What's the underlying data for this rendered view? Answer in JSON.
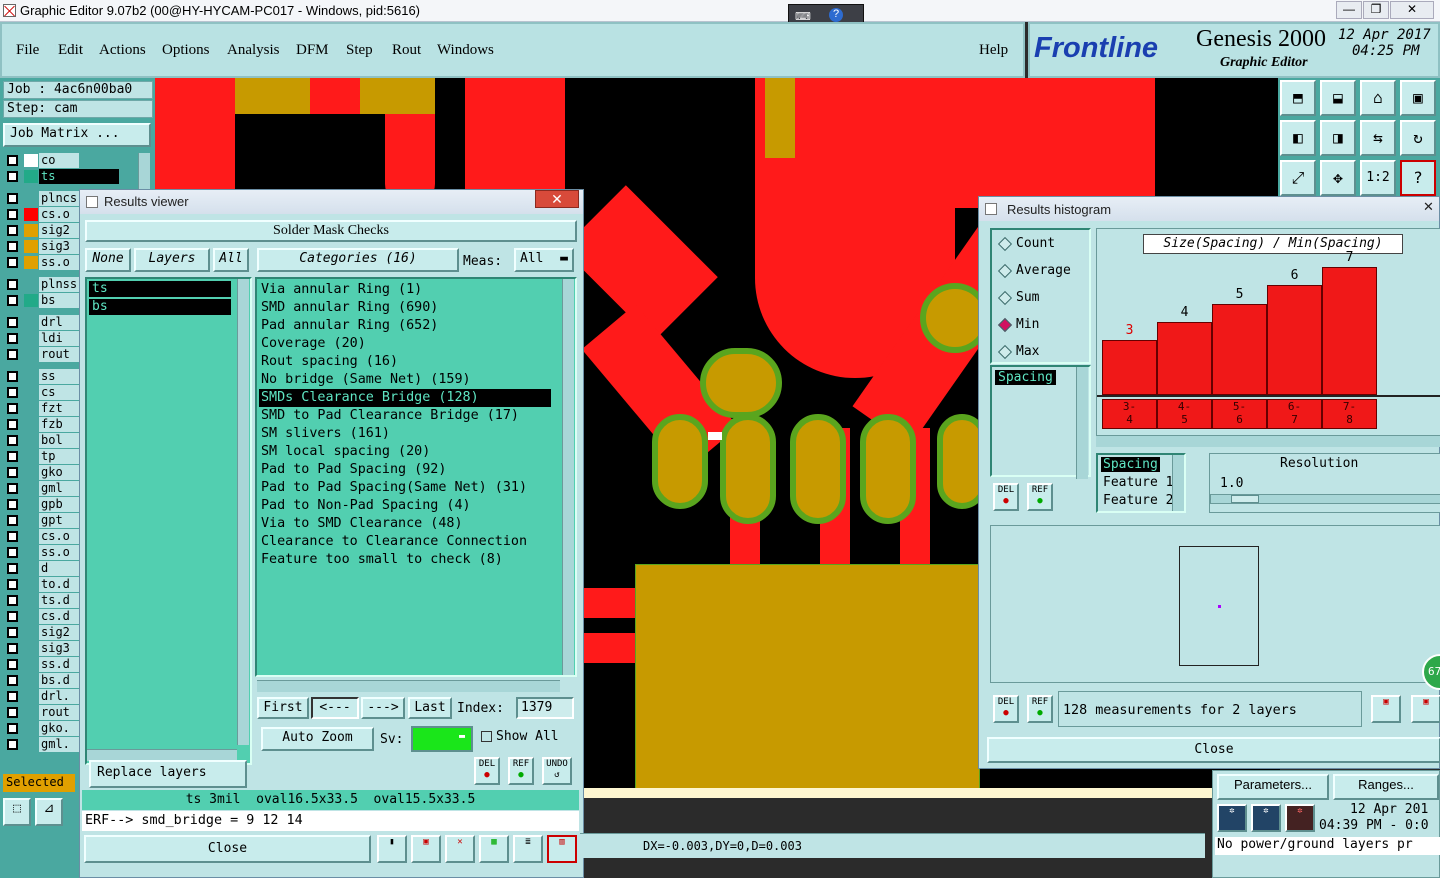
{
  "window": {
    "title": "Graphic Editor 9.07b2 (00@HY-HYCAM-PC017 - Windows, pid:5616)",
    "min": "—",
    "max": "❐",
    "close": "✕"
  },
  "menu": {
    "file": "File",
    "edit": "Edit",
    "actions": "Actions",
    "options": "Options",
    "analysis": "Analysis",
    "dfm": "DFM",
    "step": "Step",
    "rout": "Rout",
    "windows": "Windows",
    "help": "Help"
  },
  "brand": {
    "logo": "Frontline",
    "product": "Genesis 2000",
    "subtitle": "Graphic Editor",
    "date": "12 Apr 2017",
    "time": "04:25 PM"
  },
  "left": {
    "job": "Job : 4ac6n00ba0",
    "step": "Step: cam",
    "job_matrix": "Job Matrix ...",
    "layers": [
      "co",
      "ts",
      "plncs",
      "cs.o",
      "sig2",
      "sig3",
      "ss.o",
      "plnss",
      "bs",
      "drl",
      "ldi",
      "rout",
      "ss",
      "cs",
      "fzt",
      "fzb",
      "bol",
      "tp",
      "gko",
      "gml",
      "gpb",
      "gpt",
      "cs.o",
      "ss.o",
      "d",
      "to.d",
      "ts.d",
      "cs.d",
      "sig2",
      "sig3",
      "ss.d",
      "bs.d",
      "drl.",
      "rout",
      "gko.",
      "gml."
    ],
    "selected": "Selected"
  },
  "results_viewer": {
    "title": "Results viewer",
    "header": "Solder Mask Checks",
    "none": "None",
    "layers_btn": "Layers",
    "all": "All",
    "categories": "Categories (16)",
    "meas_label": "Meas:",
    "meas_value": "All",
    "layer_list": [
      "ts",
      "bs"
    ],
    "category_list": [
      "Via annular Ring (1)",
      "SMD annular Ring (690)",
      "Pad annular Ring (652)",
      "Coverage (20)",
      "Rout spacing (16)",
      "No bridge (Same Net) (159)",
      "SMDs Clearance Bridge (128)",
      "SMD to Pad Clearance Bridge (17)",
      "SM slivers (161)",
      "SM local spacing (20)",
      "Pad to Pad Spacing (92)",
      "Pad to Pad Spacing(Same Net) (31)",
      "Pad to Non-Pad Spacing (4)",
      "Via to SMD Clearance (48)",
      "Clearance to Clearance Connection",
      "Feature too small to check (8)"
    ],
    "selected_index": 6,
    "first": "First",
    "prev": "<---",
    "next": "--->",
    "last": "Last",
    "index_label": "Index:",
    "index_value": "1379",
    "auto_zoom": "Auto Zoom",
    "sv_label": "Sv:",
    "show_all": "Show All",
    "replace_layers": "Replace layers",
    "del": "DEL",
    "ref": "REF",
    "undo": "UNDO",
    "info": "ts 3mil  oval16.5x33.5  oval15.5x33.5",
    "erf": "ERF--> smd_bridge = 9 12 14",
    "close": "Close"
  },
  "histogram": {
    "title": "Results histogram",
    "modes": [
      "Count",
      "Average",
      "Sum",
      "Min",
      "Max"
    ],
    "active_mode": "Min",
    "chart_title": "Size(Spacing) / Min(Spacing)",
    "spacing_item": "Spacing",
    "del": "DEL",
    "ref": "REF",
    "feature_list": [
      "Spacing",
      "Feature 1",
      "Feature 2"
    ],
    "resolution_label": "Resolution",
    "resolution_value": "1.0",
    "measurements": "128 measurements for 2 layers",
    "close": "Close",
    "chart_data": {
      "type": "bar",
      "title": "Size(Spacing) / Min(Spacing)",
      "categories": [
        "3-4",
        "4-5",
        "5-6",
        "6-7",
        "7-8"
      ],
      "bin_labels": [
        [
          "3-",
          "4"
        ],
        [
          "4-",
          "5"
        ],
        [
          "5-",
          "6"
        ],
        [
          "6-",
          "7"
        ],
        [
          "7-",
          "8"
        ]
      ],
      "values": [
        3,
        4,
        5,
        6,
        7
      ],
      "ylim": [
        0,
        7
      ]
    }
  },
  "bottom_right": {
    "parameters": "Parameters...",
    "ranges": "Ranges...",
    "date": "12 Apr 201",
    "time": "04:39 PM - 0:0",
    "msg": "No power/ground layers pr"
  },
  "status": {
    "coords": "DX=-0.003,DY=0,D=0.003"
  },
  "badge": "67",
  "colors": {
    "panel": "#bfe4e5",
    "list": "#52cfb0",
    "copper": "#ff1a1a",
    "pad": "#c79a00",
    "outline": "#5aa51e"
  }
}
